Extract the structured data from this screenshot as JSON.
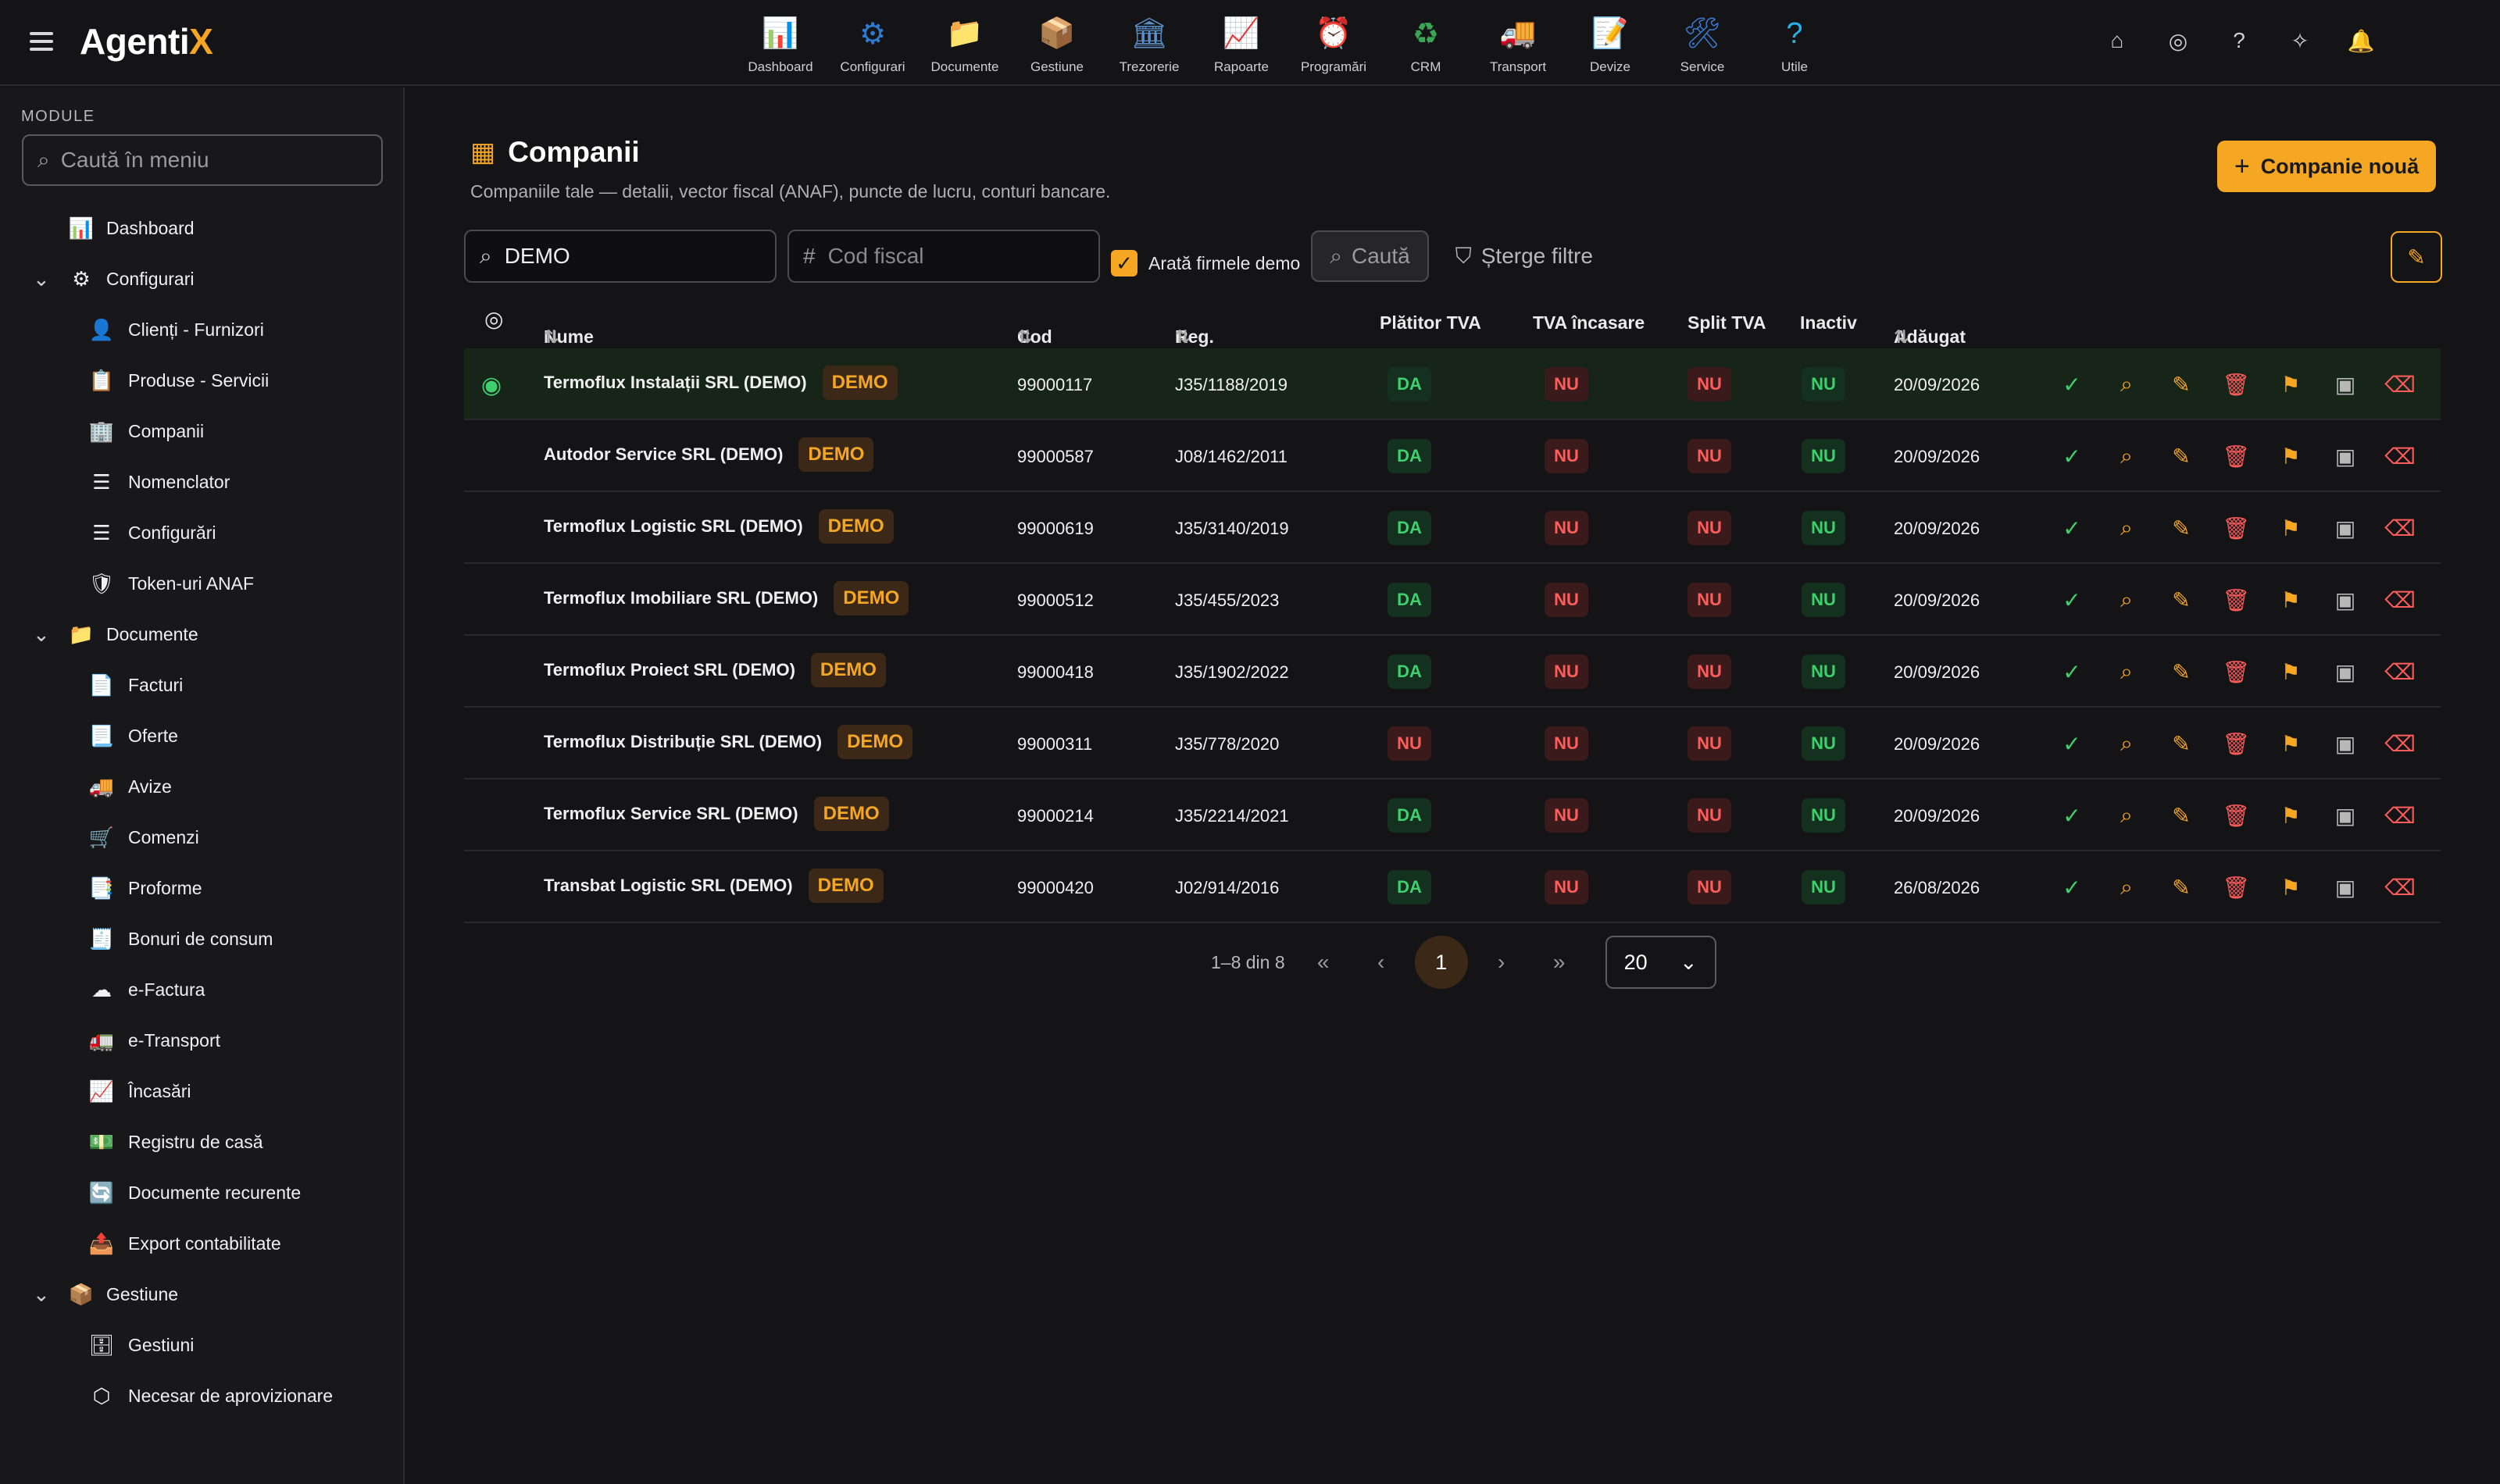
{
  "app": {
    "logo_main": "Agenti",
    "logo_accent": "X"
  },
  "topnav": [
    {
      "label": "Dashboard",
      "icon": "chart-dashboard-icon",
      "glyph": "📊",
      "color": "#e9e4da"
    },
    {
      "label": "Configurari",
      "icon": "gear-icon",
      "glyph": "⚙",
      "color": "#2e7bd6"
    },
    {
      "label": "Documente",
      "icon": "documents-icon",
      "glyph": "📁",
      "color": "#f0b84a"
    },
    {
      "label": "Gestiune",
      "icon": "warehouse-icon",
      "glyph": "📦",
      "color": "#4a8fd0"
    },
    {
      "label": "Trezorerie",
      "icon": "bank-icon",
      "glyph": "🏛",
      "color": "#5a8fc8"
    },
    {
      "label": "Rapoarte",
      "icon": "report-icon",
      "glyph": "📈",
      "color": "#e8663a"
    },
    {
      "label": "Programări",
      "icon": "clock-icon",
      "glyph": "⏰",
      "color": "#e8e8e8"
    },
    {
      "label": "CRM",
      "icon": "crm-cycle-icon",
      "glyph": "♻",
      "color": "#3aa655"
    },
    {
      "label": "Transport",
      "icon": "truck-icon",
      "glyph": "🚚",
      "color": "#4a6fd0"
    },
    {
      "label": "Devize",
      "icon": "estimate-icon",
      "glyph": "📝",
      "color": "#d8d8d8"
    },
    {
      "label": "Service",
      "icon": "service-icon",
      "glyph": "🛠",
      "color": "#3a7bd5"
    },
    {
      "label": "Utile",
      "icon": "help-icon",
      "glyph": "?",
      "color": "#2ab0e8"
    }
  ],
  "sidebar": {
    "section_label": "MODULE",
    "search_placeholder": "Caută în meniu",
    "items": [
      {
        "label": "Dashboard",
        "level": 0,
        "icon": "dashboard-icon",
        "glyph": "📊",
        "chev": ""
      },
      {
        "label": "Configurari",
        "level": 0,
        "icon": "gear-icon",
        "glyph": "⚙",
        "chev": "⌄"
      },
      {
        "label": "Clienți - Furnizori",
        "level": 1,
        "icon": "contacts-icon",
        "glyph": "👤",
        "chev": ""
      },
      {
        "label": "Produse - Servicii",
        "level": 1,
        "icon": "products-icon",
        "glyph": "📋",
        "chev": ""
      },
      {
        "label": "Companii",
        "level": 1,
        "icon": "company-icon",
        "glyph": "🏢",
        "chev": ""
      },
      {
        "label": "Nomenclator",
        "level": 1,
        "icon": "list-icon",
        "glyph": "☰",
        "chev": ""
      },
      {
        "label": "Configurări",
        "level": 1,
        "icon": "settings-list-icon",
        "glyph": "☰",
        "chev": ""
      },
      {
        "label": "Token-uri ANAF",
        "level": 1,
        "icon": "shield-icon",
        "glyph": "🛡",
        "chev": ""
      },
      {
        "label": "Documente",
        "level": 0,
        "icon": "documents-icon",
        "glyph": "📁",
        "chev": "⌄"
      },
      {
        "label": "Facturi",
        "level": 1,
        "icon": "invoice-icon",
        "glyph": "📄",
        "chev": ""
      },
      {
        "label": "Oferte",
        "level": 1,
        "icon": "offer-icon",
        "glyph": "📃",
        "chev": ""
      },
      {
        "label": "Avize",
        "level": 1,
        "icon": "delivery-icon",
        "glyph": "🚚",
        "chev": ""
      },
      {
        "label": "Comenzi",
        "level": 1,
        "icon": "cart-icon",
        "glyph": "🛒",
        "chev": ""
      },
      {
        "label": "Proforme",
        "level": 1,
        "icon": "proforma-icon",
        "glyph": "📑",
        "chev": ""
      },
      {
        "label": "Bonuri de consum",
        "level": 1,
        "icon": "receipt-icon",
        "glyph": "🧾",
        "chev": ""
      },
      {
        "label": "e-Factura",
        "level": 1,
        "icon": "cloud-icon",
        "glyph": "☁",
        "chev": ""
      },
      {
        "label": "e-Transport",
        "level": 1,
        "icon": "transport-icon",
        "glyph": "🚛",
        "chev": ""
      },
      {
        "label": "Încasări",
        "level": 1,
        "icon": "income-chart-icon",
        "glyph": "📈",
        "chev": ""
      },
      {
        "label": "Registru de casă",
        "level": 1,
        "icon": "cash-register-icon",
        "glyph": "💵",
        "chev": ""
      },
      {
        "label": "Documente recurente",
        "level": 1,
        "icon": "recurring-icon",
        "glyph": "🔄",
        "chev": ""
      },
      {
        "label": "Export contabilitate",
        "level": 1,
        "icon": "export-icon",
        "glyph": "📤",
        "chev": ""
      },
      {
        "label": "Gestiune",
        "level": 0,
        "icon": "warehouse-icon",
        "glyph": "📦",
        "chev": "⌄"
      },
      {
        "label": "Gestiuni",
        "level": 1,
        "icon": "inventory-icon",
        "glyph": "🗄",
        "chev": ""
      },
      {
        "label": "Necesar de aprovizionare",
        "level": 1,
        "icon": "supply-icon",
        "glyph": "⬡",
        "chev": ""
      }
    ]
  },
  "page": {
    "title": "Companii",
    "subtitle": "Companiile tale — detalii, vector fiscal (ANAF), puncte de lucru, conturi bancare.",
    "new_button": "Companie nouă"
  },
  "filters": {
    "name_value": "DEMO",
    "cod_placeholder": "Cod fiscal",
    "show_demo_label": "Arată firmele demo",
    "search_button": "Caută",
    "clear_button": "Șterge filtre"
  },
  "table": {
    "headers": {
      "name": "Nume",
      "cod": "Cod fiscal",
      "reg": "Reg. com.",
      "platitor": "Plătitor TVA",
      "tva_incasare": "TVA încasare",
      "split": "Split TVA",
      "inactiv": "Inactiv",
      "added": "Adăugat"
    },
    "demo_badge": "DEMO",
    "rows": [
      {
        "name": "Termoflux Instalații SRL (DEMO)",
        "cod": "99000117",
        "reg": "J35/1188/2019",
        "platitor": "DA",
        "tva_incasare": "NU",
        "split": "NU",
        "inactiv": "NU",
        "added": "20/09/2026",
        "selected": true
      },
      {
        "name": "Autodor Service SRL (DEMO)",
        "cod": "99000587",
        "reg": "J08/1462/2011",
        "platitor": "DA",
        "tva_incasare": "NU",
        "split": "NU",
        "inactiv": "NU",
        "added": "20/09/2026",
        "selected": false
      },
      {
        "name": "Termoflux Logistic SRL (DEMO)",
        "cod": "99000619",
        "reg": "J35/3140/2019",
        "platitor": "DA",
        "tva_incasare": "NU",
        "split": "NU",
        "inactiv": "NU",
        "added": "20/09/2026",
        "selected": false
      },
      {
        "name": "Termoflux Imobiliare SRL (DEMO)",
        "cod": "99000512",
        "reg": "J35/455/2023",
        "platitor": "DA",
        "tva_incasare": "NU",
        "split": "NU",
        "inactiv": "NU",
        "added": "20/09/2026",
        "selected": false
      },
      {
        "name": "Termoflux Proiect SRL (DEMO)",
        "cod": "99000418",
        "reg": "J35/1902/2022",
        "platitor": "DA",
        "tva_incasare": "NU",
        "split": "NU",
        "inactiv": "NU",
        "added": "20/09/2026",
        "selected": false
      },
      {
        "name": "Termoflux Distribuție SRL (DEMO)",
        "cod": "99000311",
        "reg": "J35/778/2020",
        "platitor": "NU",
        "tva_incasare": "NU",
        "split": "NU",
        "inactiv": "NU",
        "added": "20/09/2026",
        "selected": false
      },
      {
        "name": "Termoflux Service SRL (DEMO)",
        "cod": "99000214",
        "reg": "J35/2214/2021",
        "platitor": "DA",
        "tva_incasare": "NU",
        "split": "NU",
        "inactiv": "NU",
        "added": "20/09/2026",
        "selected": false
      },
      {
        "name": "Transbat Logistic SRL (DEMO)",
        "cod": "99000420",
        "reg": "J02/914/2016",
        "platitor": "DA",
        "tva_incasare": "NU",
        "split": "NU",
        "inactiv": "NU",
        "added": "26/08/2026",
        "selected": false
      }
    ]
  },
  "pager": {
    "range": "1–8 din 8",
    "current_page": "1",
    "page_size": "20"
  }
}
